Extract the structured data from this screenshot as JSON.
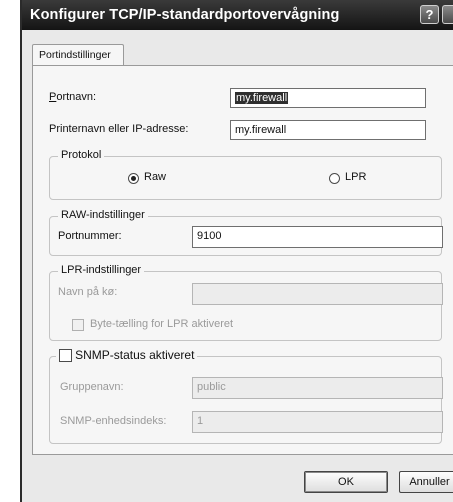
{
  "window": {
    "title": "Konfigurer TCP/IP-standardportovervågning",
    "help_glyph": "?"
  },
  "tabs": [
    {
      "label": "Portindstillinger"
    }
  ],
  "port_settings": {
    "port_name_label": "Portnavn:",
    "port_name_value": "my.firewall",
    "printer_label": "Printernavn eller IP-adresse:",
    "printer_value": "my.firewall"
  },
  "protocol": {
    "legend": "Protokol",
    "raw_label": "Raw",
    "lpr_label": "LPR",
    "selected": "Raw"
  },
  "raw_settings": {
    "legend": "RAW-indstillinger",
    "port_number_label": "Portnummer:",
    "port_number_value": "9100"
  },
  "lpr_settings": {
    "legend": "LPR-indstillinger",
    "queue_name_label": "Navn på kø:",
    "queue_name_value": "",
    "byte_count_label": "Byte-tælling for LPR aktiveret",
    "byte_count_checked": false
  },
  "snmp": {
    "legend": "SNMP-status aktiveret",
    "enabled": false,
    "community_label": "Gruppenavn:",
    "community_value": "public",
    "device_index_label": "SNMP-enhedsindeks:",
    "device_index_value": "1"
  },
  "buttons": {
    "ok": "OK",
    "cancel": "Annuller"
  }
}
